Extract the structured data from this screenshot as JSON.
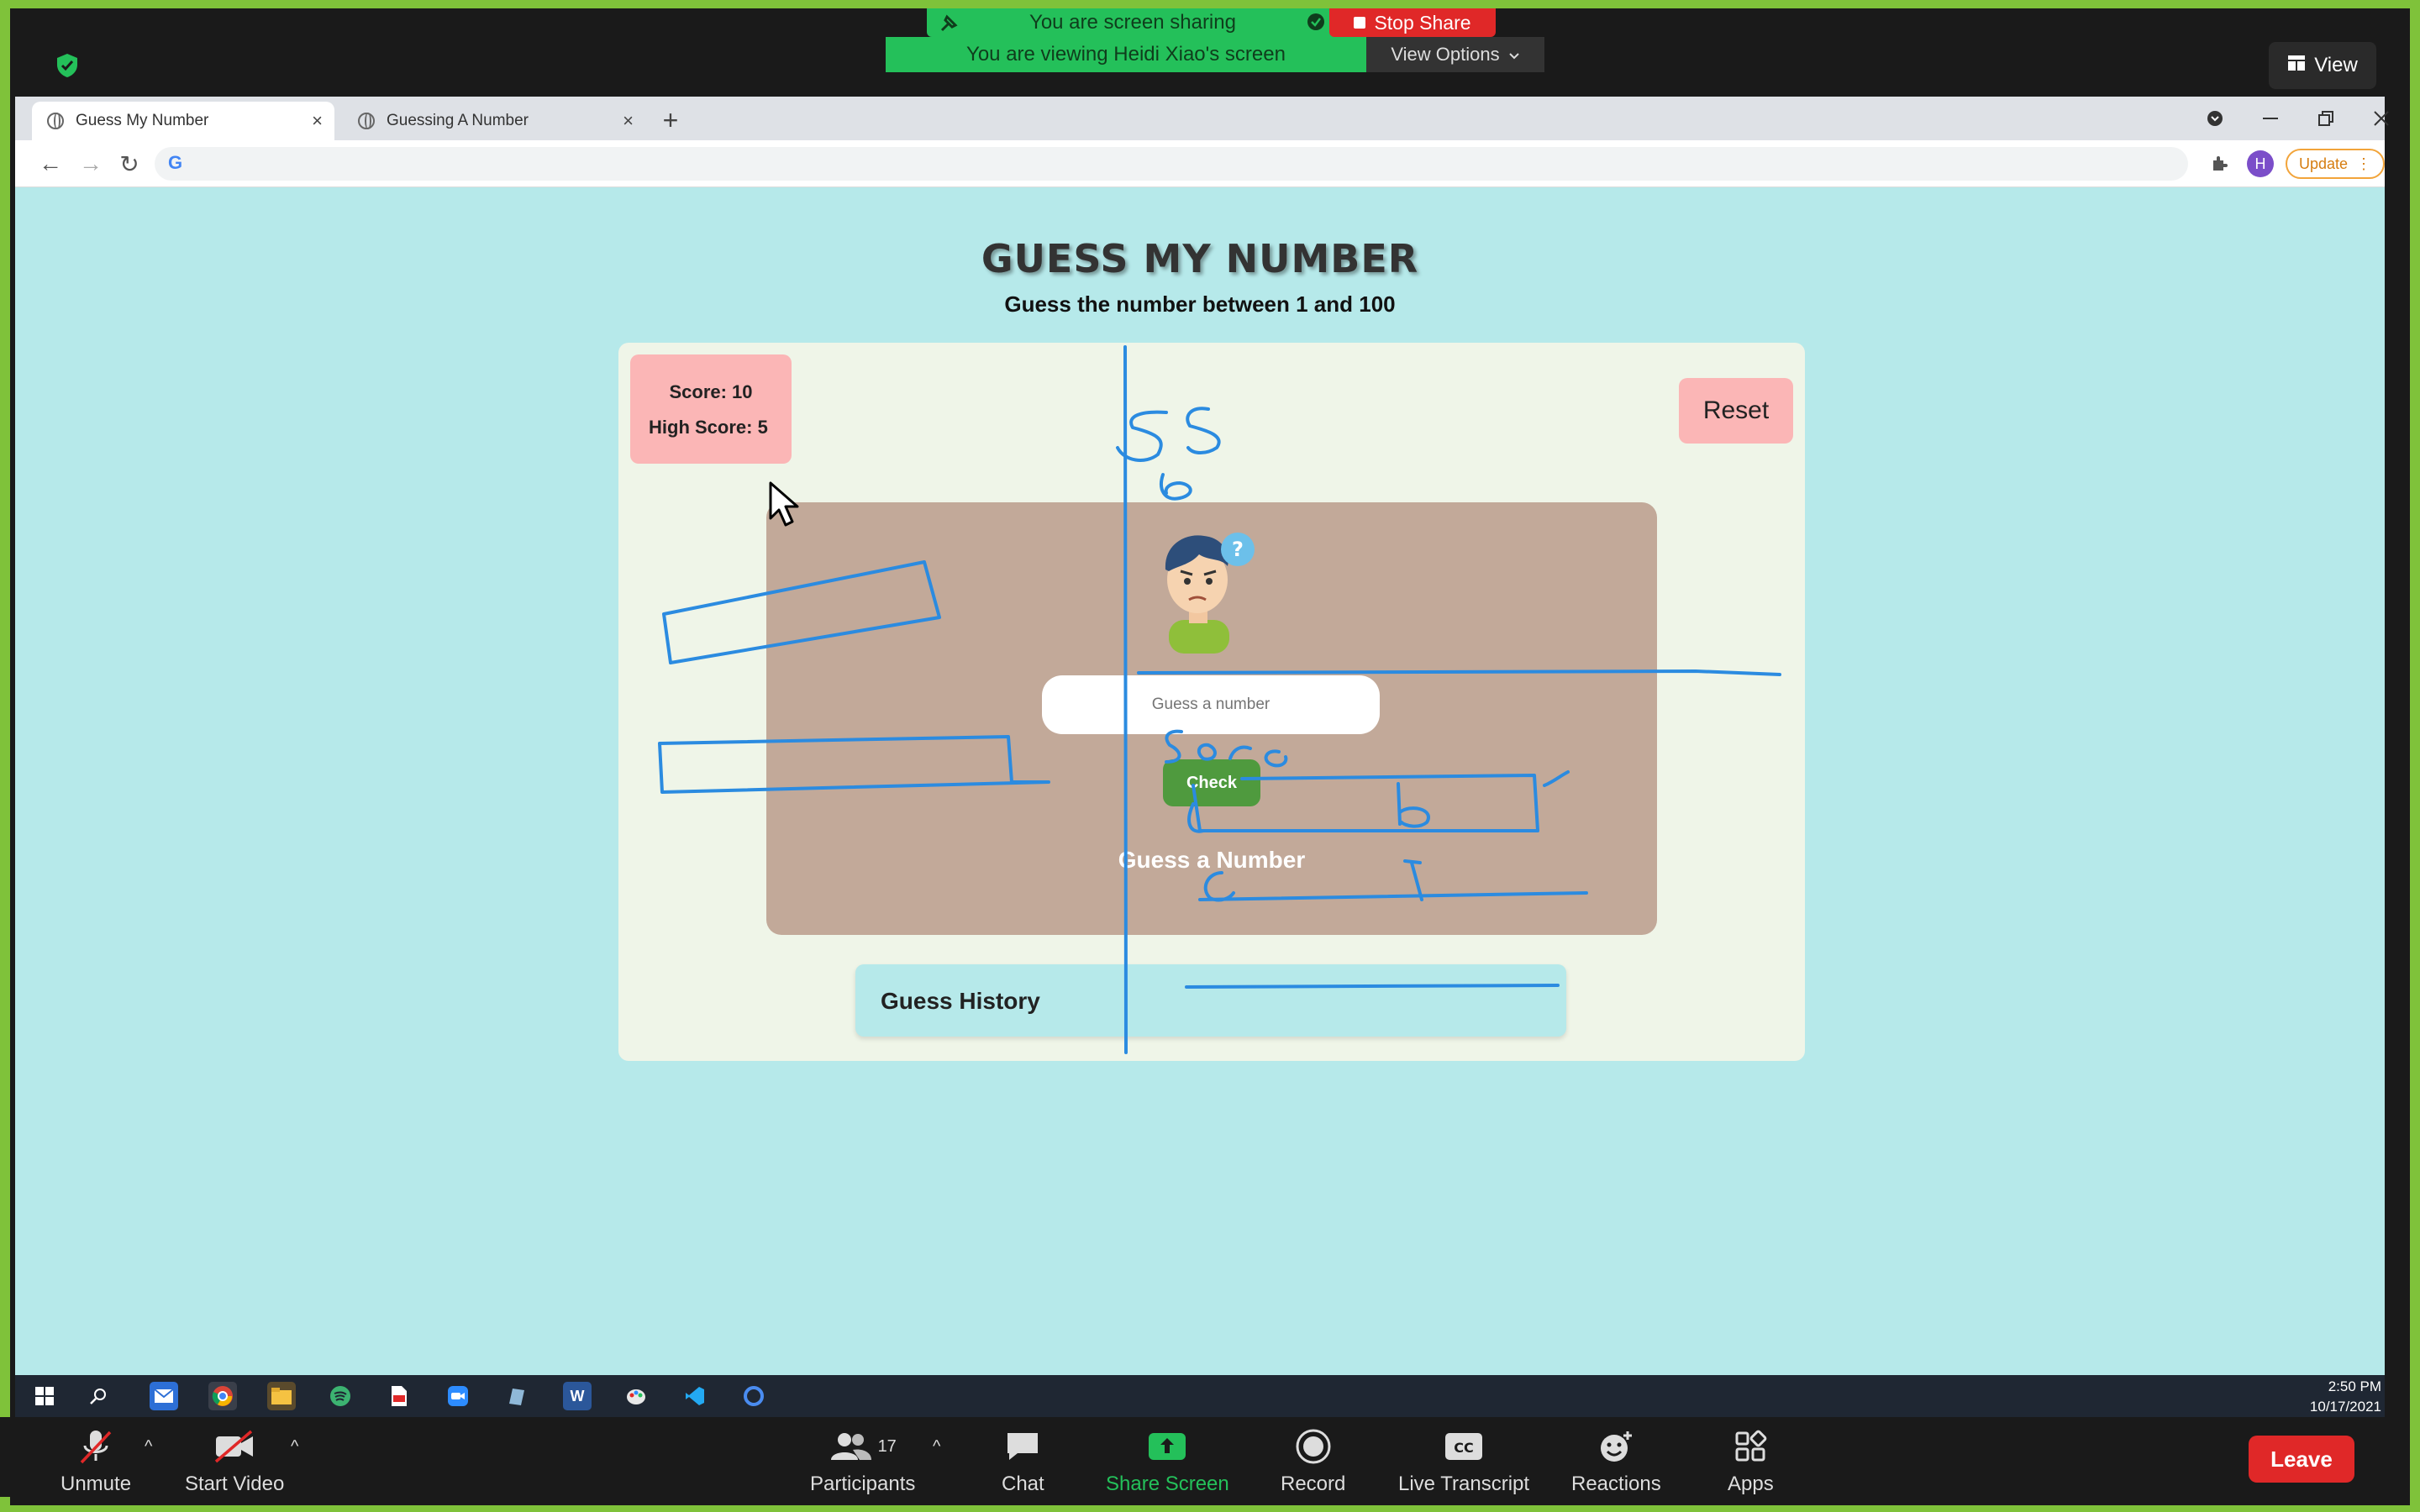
{
  "zoom": {
    "sharing_banner": "You are screen sharing",
    "stop_share": "Stop Share",
    "viewing_banner": "You are viewing Heidi Xiao's screen",
    "view_options": "View Options",
    "view_button": "View",
    "controls": {
      "unmute": "Unmute",
      "start_video": "Start Video",
      "participants": "Participants",
      "participants_count": "17",
      "chat": "Chat",
      "share_screen": "Share Screen",
      "record": "Record",
      "live_transcript": "Live Transcript",
      "reactions": "Reactions",
      "apps": "Apps",
      "leave": "Leave"
    },
    "colors": {
      "green": "#24c05a",
      "red": "#e02828",
      "frame_border": "#7fc23a"
    }
  },
  "browser": {
    "tabs": [
      {
        "title": "Guess My Number",
        "active": true
      },
      {
        "title": "Guessing A Number",
        "active": false
      }
    ],
    "new_tab": "+",
    "close_tab": "×",
    "nav": {
      "back": "←",
      "forward": "→",
      "reload": "↻"
    },
    "omnibox_logo": "G",
    "profile_initial": "H",
    "update_label": "Update"
  },
  "game": {
    "title": "GUESS MY NUMBER",
    "subtitle": "Guess the number between 1 and 100",
    "score_label": "Score: 10",
    "high_score_label": "High Score: 5",
    "reset": "Reset",
    "input_placeholder": "Guess a number",
    "check": "Check",
    "status": "Guess a Number",
    "history_title": "Guess History",
    "colors": {
      "page_bg": "#b6e9ea",
      "card_bg": "#eff5e8",
      "score_bg": "#fbb6b6",
      "inner_bg": "#c2a999",
      "check_bg": "#4f9a3e",
      "annotation": "#2b8be0"
    }
  },
  "taskbar": {
    "time": "2:50 PM",
    "date": "10/17/2021",
    "word_letter": "W"
  }
}
